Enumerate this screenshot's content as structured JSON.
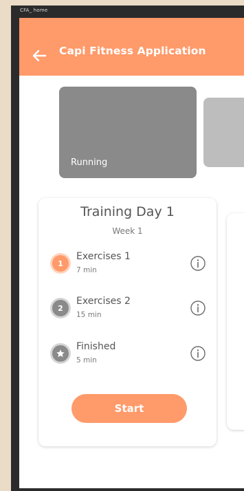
{
  "window": {
    "label": "CFA_ home"
  },
  "appbar": {
    "title": "Capi Fitness Application",
    "back_icon": "arrow-left-icon"
  },
  "carousel": {
    "cards": [
      {
        "label": "Running"
      },
      {
        "label": ""
      }
    ]
  },
  "training": {
    "title": "Training Day 1",
    "subtitle": "Week 1",
    "steps": [
      {
        "badge": "1",
        "title": "Exercises 1",
        "duration": "7 min",
        "state": "active"
      },
      {
        "badge": "2",
        "title": "Exercises 2",
        "duration": "15 min",
        "state": "idle"
      },
      {
        "badge": "",
        "title": "Finished",
        "duration": "5 min",
        "state": "idle",
        "icon": "star-icon"
      }
    ],
    "start_label": "Start"
  },
  "colors": {
    "accent": "#ff9a6a",
    "card_primary": "#8a8a8a",
    "card_secondary": "#bdbdbd",
    "text_dark": "#555555"
  }
}
